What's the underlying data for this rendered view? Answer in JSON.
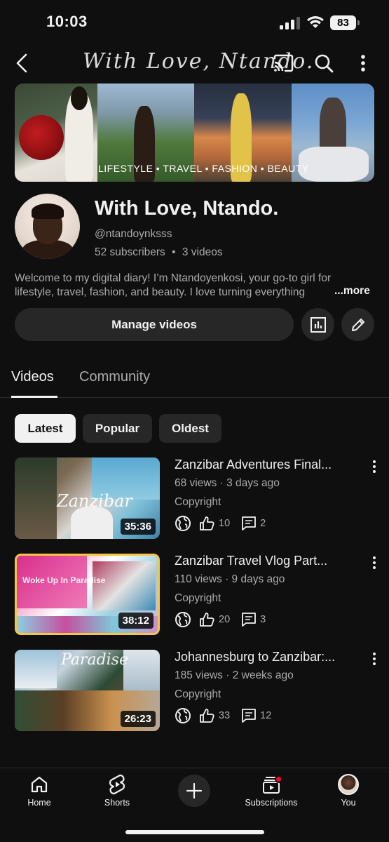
{
  "status_bar": {
    "time": "10:03",
    "battery": "83"
  },
  "banner": {
    "script_text": "With Love, Ntando.",
    "tagline": "LIFESTYLE • TRAVEL • FASHION • BEAUTY"
  },
  "channel": {
    "name": "With Love, Ntando.",
    "handle": "@ntandoynksss",
    "subscribers": "52 subscribers",
    "separator": "•",
    "videos_count": "3 videos",
    "description_line1": "Welcome to my digital diary! I’m Ntandoyenkosi, your go-to girl for",
    "description_line2": "lifestyle, travel, fashion, and beauty. I love turning everything",
    "more_label": "...more",
    "manage_label": "Manage videos"
  },
  "tabs": [
    {
      "label": "Videos",
      "active": true
    },
    {
      "label": "Community",
      "active": false
    }
  ],
  "filters": [
    {
      "label": "Latest",
      "selected": true
    },
    {
      "label": "Popular",
      "selected": false
    },
    {
      "label": "Oldest",
      "selected": false
    }
  ],
  "videos": [
    {
      "title": "Zanzibar Adventures Final...",
      "meta": "68 views · 3 days ago",
      "status": "Copyright",
      "likes": "10",
      "comments": "2",
      "duration": "35:36",
      "thumb_text": "Zanzibar"
    },
    {
      "title": "Zanzibar Travel Vlog Part...",
      "meta": "110 views · 9 days ago",
      "status": "Copyright",
      "likes": "20",
      "comments": "3",
      "duration": "38:12",
      "thumb_text": "Woke Up In Paradise"
    },
    {
      "title": "Johannesburg to Zanzibar:...",
      "meta": "185 views · 2 weeks ago",
      "status": "Copyright",
      "likes": "33",
      "comments": "12",
      "duration": "26:23",
      "thumb_text": "Paradise"
    }
  ],
  "bottom_nav": {
    "home": "Home",
    "shorts": "Shorts",
    "subscriptions": "Subscriptions",
    "you": "You"
  },
  "colors": {
    "background": "#0f0f0f",
    "surface": "#272727",
    "text_primary": "#f1f1f1",
    "text_secondary": "#aaaaaa",
    "notification": "#ff0033"
  },
  "icons": [
    "back-arrow-icon",
    "cast-icon",
    "search-icon",
    "more-vertical-icon",
    "analytics-icon",
    "edit-pencil-icon",
    "globe-icon",
    "thumbs-up-icon",
    "comment-icon",
    "home-icon",
    "shorts-icon",
    "add-icon",
    "subscriptions-icon"
  ]
}
